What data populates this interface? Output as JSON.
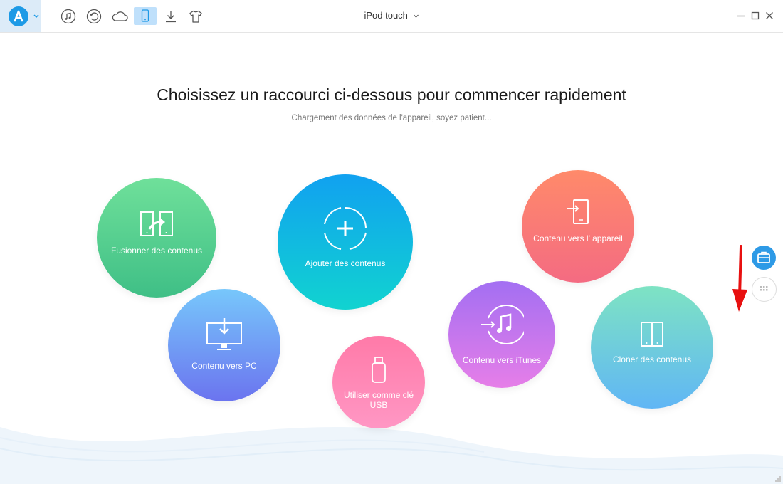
{
  "toolbar": {
    "device_title": "iPod touch",
    "icons": [
      "logo-icon",
      "music-icon",
      "history-icon",
      "cloud-icon",
      "device-icon",
      "download-icon",
      "tshirt-icon"
    ]
  },
  "main": {
    "headline": "Choisissez un raccourci ci-dessous pour commencer rapidement",
    "subtitle": "Chargement des données de l'appareil, soyez patient..."
  },
  "shortcuts": {
    "merge": "Fusionner des contenus",
    "add": "Ajouter des contenus",
    "to_device": "Contenu vers l’ appareil",
    "to_pc": "Contenu vers PC",
    "usb": "Utiliser comme clé USB",
    "to_itunes": "Contenu vers iTunes",
    "clone": "Cloner des contenus"
  },
  "colors": {
    "accent": "#1d9ae6",
    "annotation_arrow": "#e81010"
  }
}
